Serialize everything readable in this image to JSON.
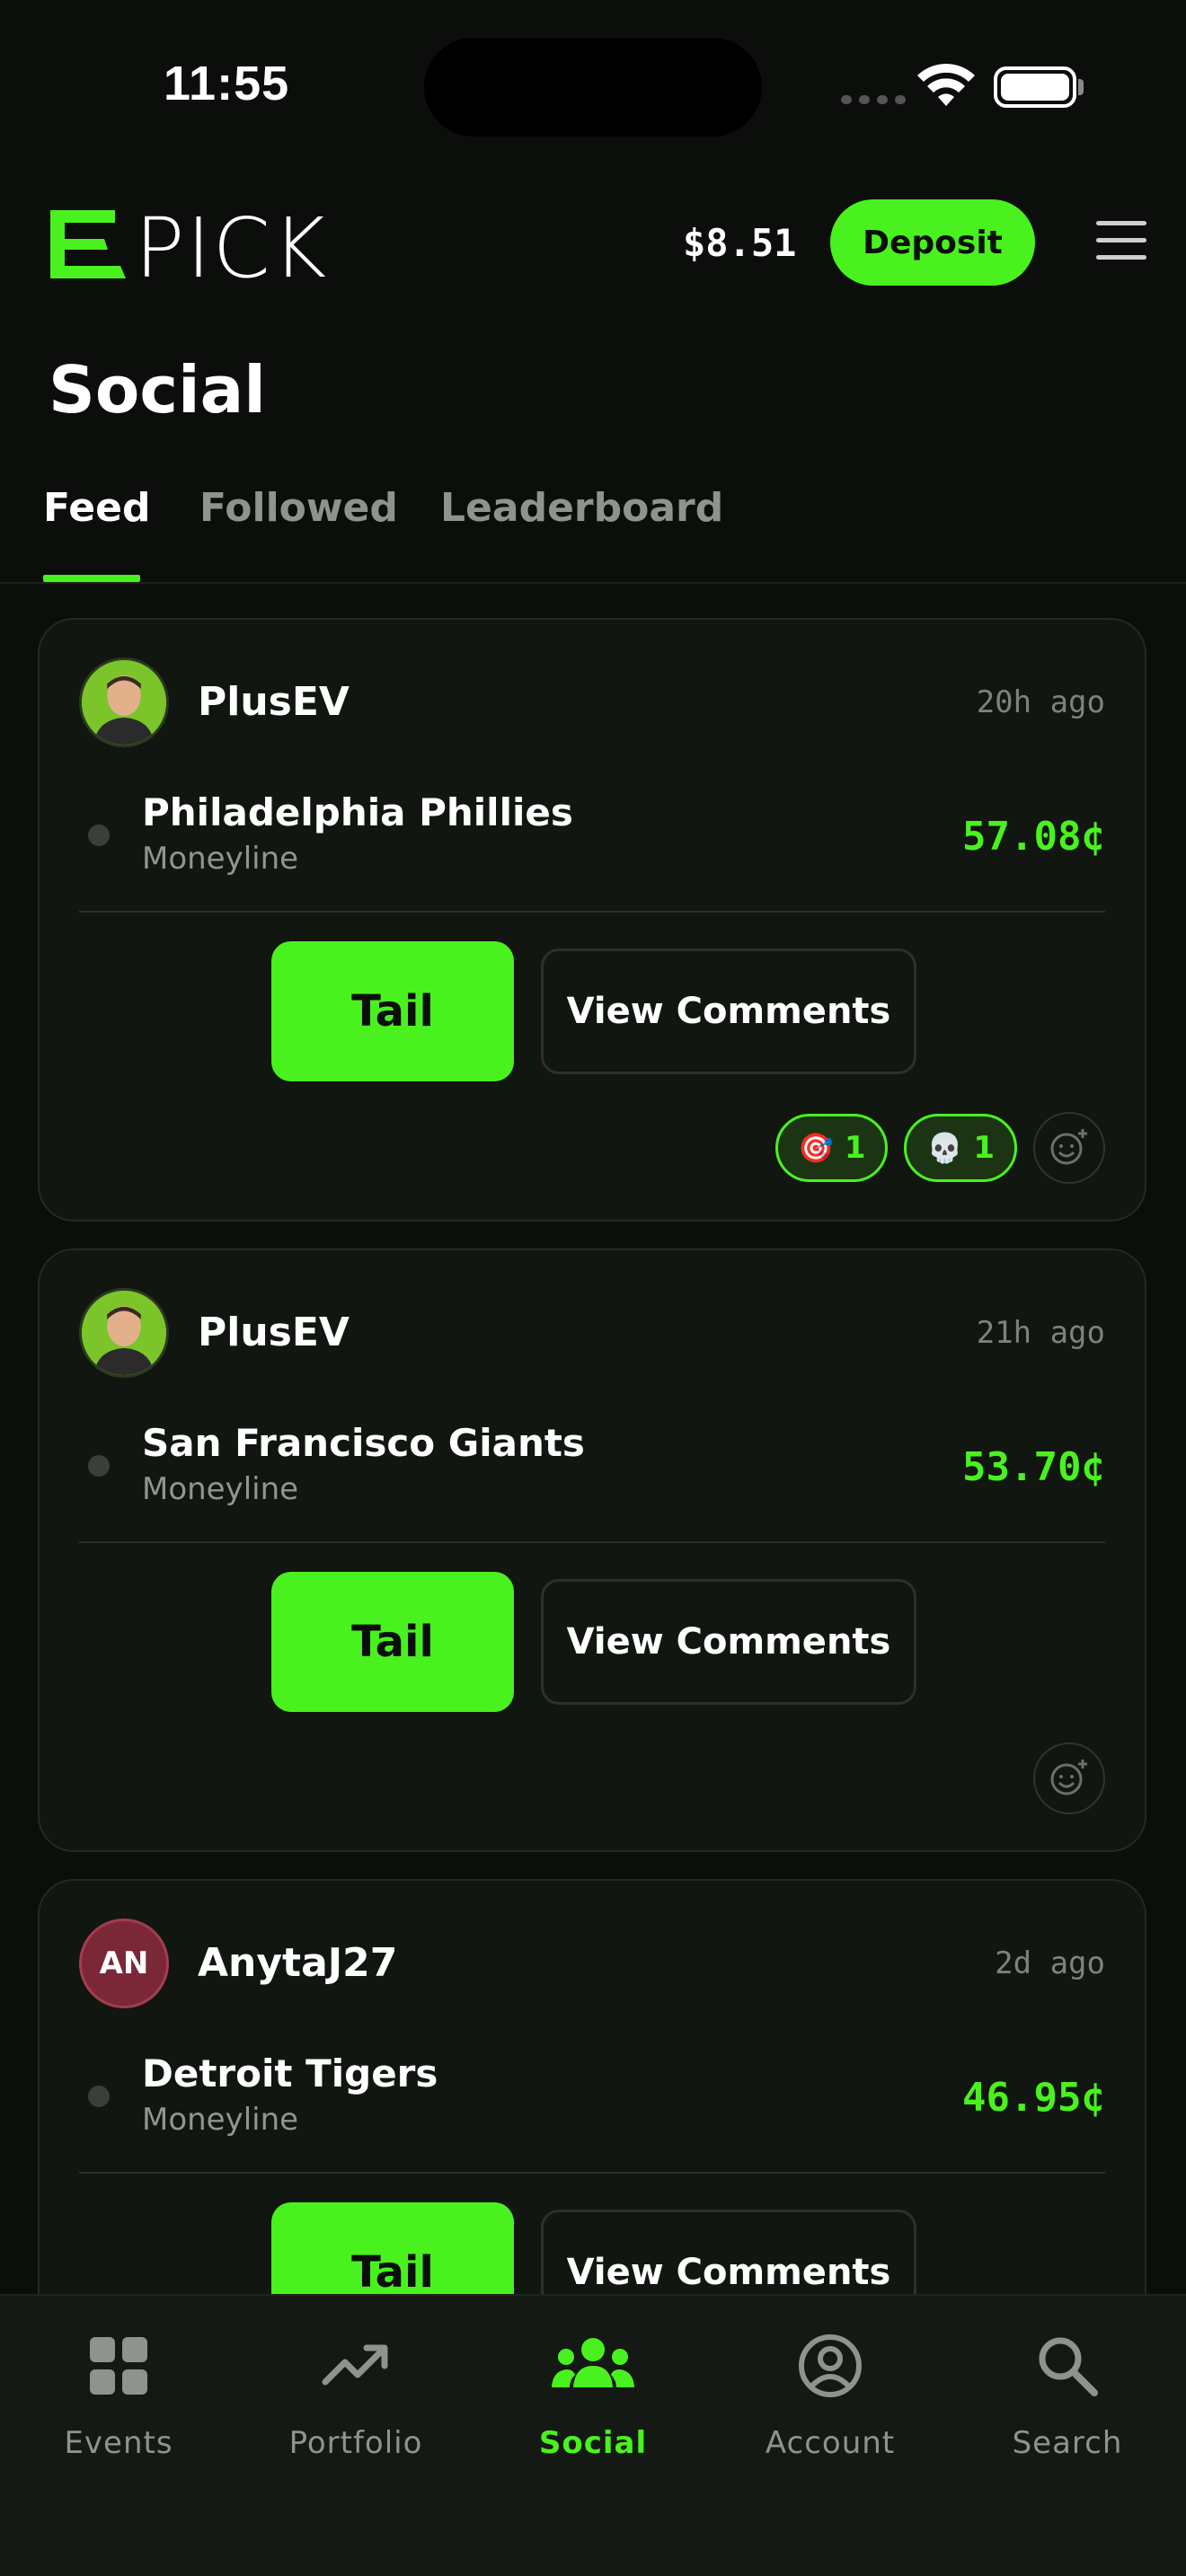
{
  "status_bar": {
    "time": "11:55"
  },
  "header": {
    "logo_text": "EPICK",
    "balance": "$8.51",
    "deposit_label": "Deposit"
  },
  "page": {
    "title": "Social"
  },
  "tabs": [
    {
      "label": "Feed",
      "active": true
    },
    {
      "label": "Followed",
      "active": false
    },
    {
      "label": "Leaderboard",
      "active": false
    }
  ],
  "feed": [
    {
      "username": "PlusEV",
      "avatar_type": "photo",
      "time_ago": "20h ago",
      "team": "Philadelphia Phillies",
      "market": "Moneyline",
      "price": "57.08¢",
      "tail_label": "Tail",
      "comments_label": "View Comments",
      "reactions": [
        {
          "emoji": "🎯",
          "count": "1"
        },
        {
          "emoji": "💀",
          "count": "1"
        }
      ]
    },
    {
      "username": "PlusEV",
      "avatar_type": "photo",
      "time_ago": "21h ago",
      "team": "San Francisco Giants",
      "market": "Moneyline",
      "price": "53.70¢",
      "tail_label": "Tail",
      "comments_label": "View Comments",
      "reactions": []
    },
    {
      "username": "AnytaJ27",
      "avatar_type": "initials",
      "avatar_initials": "AN",
      "time_ago": "2d ago",
      "team": "Detroit Tigers",
      "market": "Moneyline",
      "price": "46.95¢",
      "tail_label": "Tail",
      "comments_label": "View Comments",
      "reactions": []
    }
  ],
  "bottom_nav": [
    {
      "label": "Events",
      "icon": "grid-icon",
      "active": false
    },
    {
      "label": "Portfolio",
      "icon": "trending-up-icon",
      "active": false
    },
    {
      "label": "Social",
      "icon": "people-icon",
      "active": true
    },
    {
      "label": "Account",
      "icon": "user-circle-icon",
      "active": false
    },
    {
      "label": "Search",
      "icon": "search-icon",
      "active": false
    }
  ],
  "colors": {
    "accent": "#49f21f",
    "background": "#0b0e0b",
    "card": "#111611",
    "muted_text": "#8d938d"
  }
}
